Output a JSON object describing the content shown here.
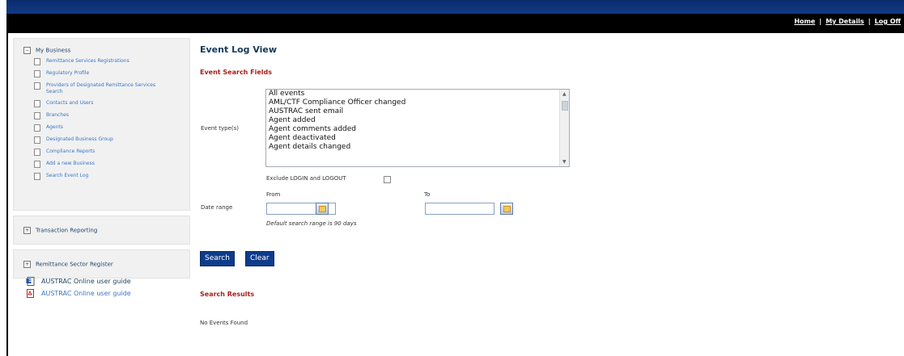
{
  "header": {
    "subtitle": "",
    "links": [
      {
        "label": "Home"
      },
      {
        "label": "My Details"
      },
      {
        "label": "Log Off"
      }
    ],
    "separator": "|"
  },
  "sidebar": {
    "my_business": {
      "expander": "−",
      "title": "My Business",
      "items": [
        {
          "label": "Remittance Services Registrations"
        },
        {
          "label": "Regulatory Profile"
        },
        {
          "label": "Providers of Designated Remittance Services Search"
        },
        {
          "label": "Contacts and Users"
        },
        {
          "label": "Branches"
        },
        {
          "label": "Agents"
        },
        {
          "label": "Designated Business Group"
        },
        {
          "label": "Compliance Reports"
        },
        {
          "label": "Add a new Business"
        },
        {
          "label": "Search Event Log"
        }
      ]
    },
    "transaction_reporting": {
      "expander": "+",
      "title": "Transaction Reporting"
    },
    "remittance_register": {
      "expander": "+",
      "title": "Remittance Sector Register"
    },
    "guides": [
      {
        "label": "AUSTRAC Online user guide",
        "icon": "word-document-icon"
      },
      {
        "label": "AUSTRAC Online user guide",
        "icon": "pdf-document-icon"
      }
    ]
  },
  "main": {
    "title": "Event Log View",
    "search_fields_heading": "Event Search Fields",
    "event_types_label": "Event type(s)",
    "event_types": [
      "All events",
      "AML/CTF Compliance Officer changed",
      "AUSTRAC sent email",
      "Agent added",
      "Agent comments added",
      "Agent deactivated",
      "Agent details changed"
    ],
    "exclude_label": "Exclude LOGIN and LOGOUT",
    "exclude_checked": false,
    "date_range_label": "Date range",
    "from_label": "From",
    "to_label": "To",
    "from_value": "",
    "to_value": "",
    "default_hint": "Default search range is 90 days",
    "search_button": "Search",
    "clear_button": "Clear",
    "results_heading": "Search Results",
    "results_text": "No Events Found"
  },
  "colors": {
    "banner": "#0a2b6b",
    "topbar": "#000000",
    "button": "#0f3c8a",
    "section_heading": "#a8201a",
    "title": "#17385e",
    "link": "#3a77c8"
  }
}
